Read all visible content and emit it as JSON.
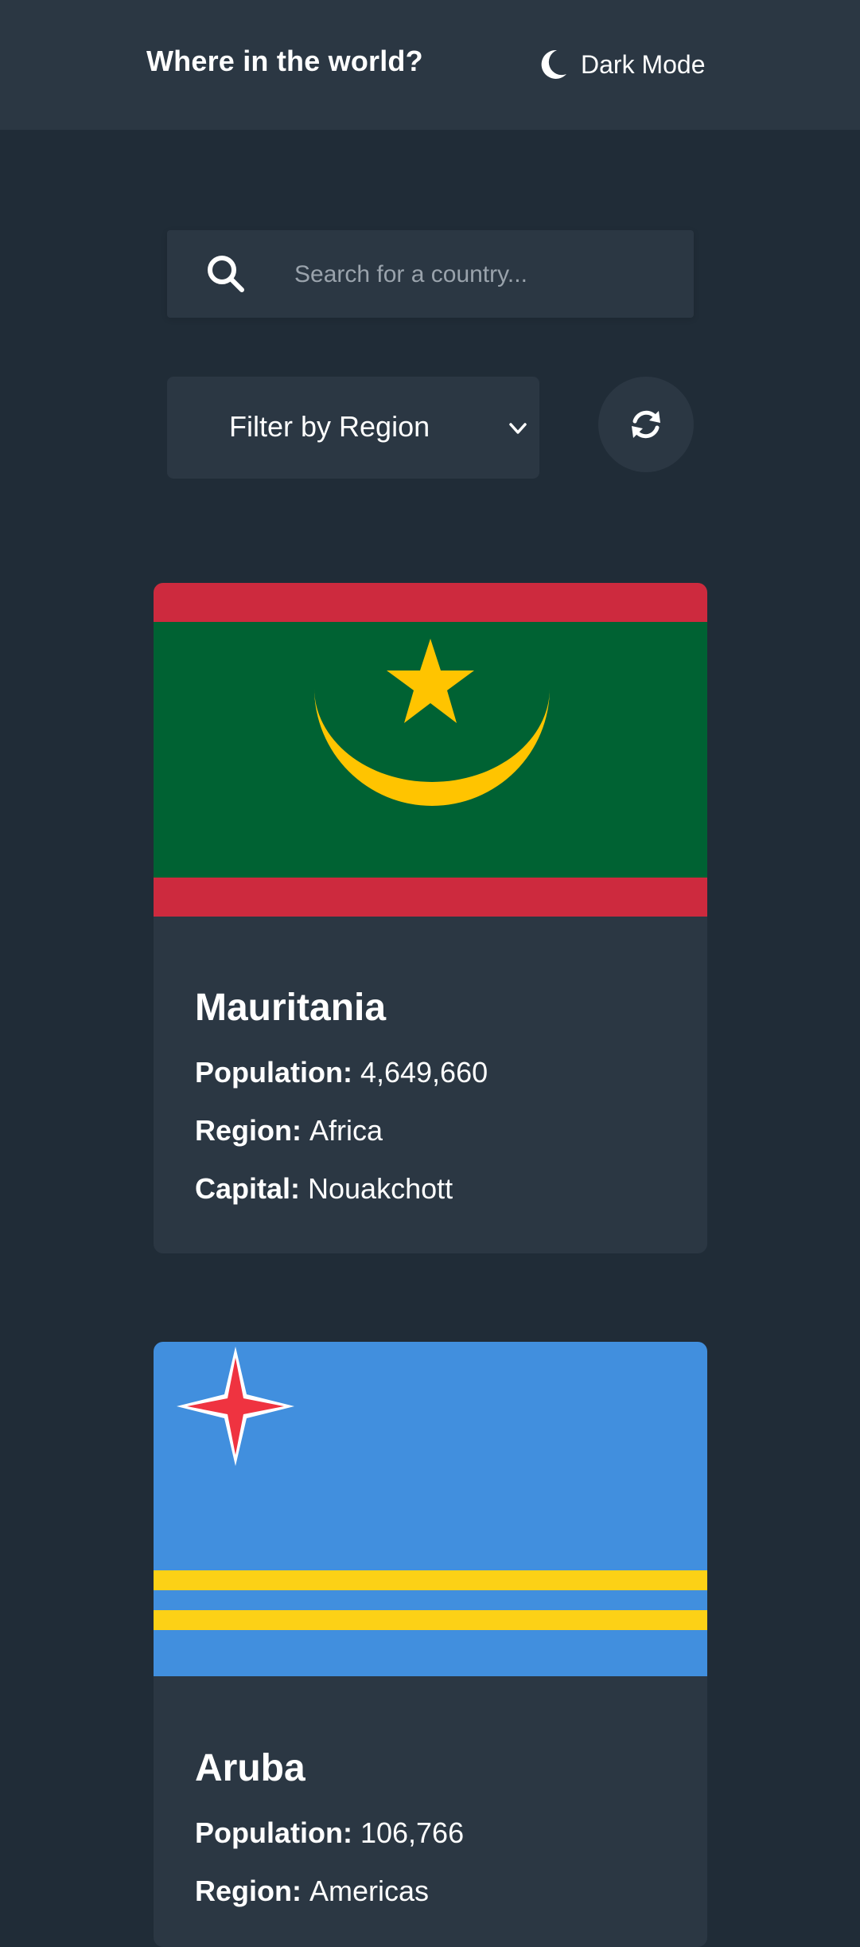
{
  "header": {
    "title": "Where in the world?",
    "theme_toggle_label": "Dark Mode",
    "theme_icon": "moon-icon"
  },
  "search": {
    "placeholder": "Search for a country...",
    "value": "",
    "icon": "search-icon"
  },
  "filter": {
    "label": "Filter by Region",
    "icon": "chevron-down-icon"
  },
  "refresh": {
    "icon": "refresh-icon"
  },
  "countries": [
    {
      "name": "Mauritania",
      "population_label": "Population:",
      "population": "4,649,660",
      "region_label": "Region:",
      "region": "Africa",
      "capital_label": "Capital:",
      "capital": "Nouakchott",
      "flag": "mauritania-flag"
    },
    {
      "name": "Aruba",
      "population_label": "Population:",
      "population": "106,766",
      "region_label": "Region:",
      "region": "Americas",
      "flag": "aruba-flag"
    }
  ],
  "colors": {
    "background": "#202c37",
    "surface": "#2b3743",
    "text": "#ffffff",
    "placeholder": "#9aa3ac"
  }
}
